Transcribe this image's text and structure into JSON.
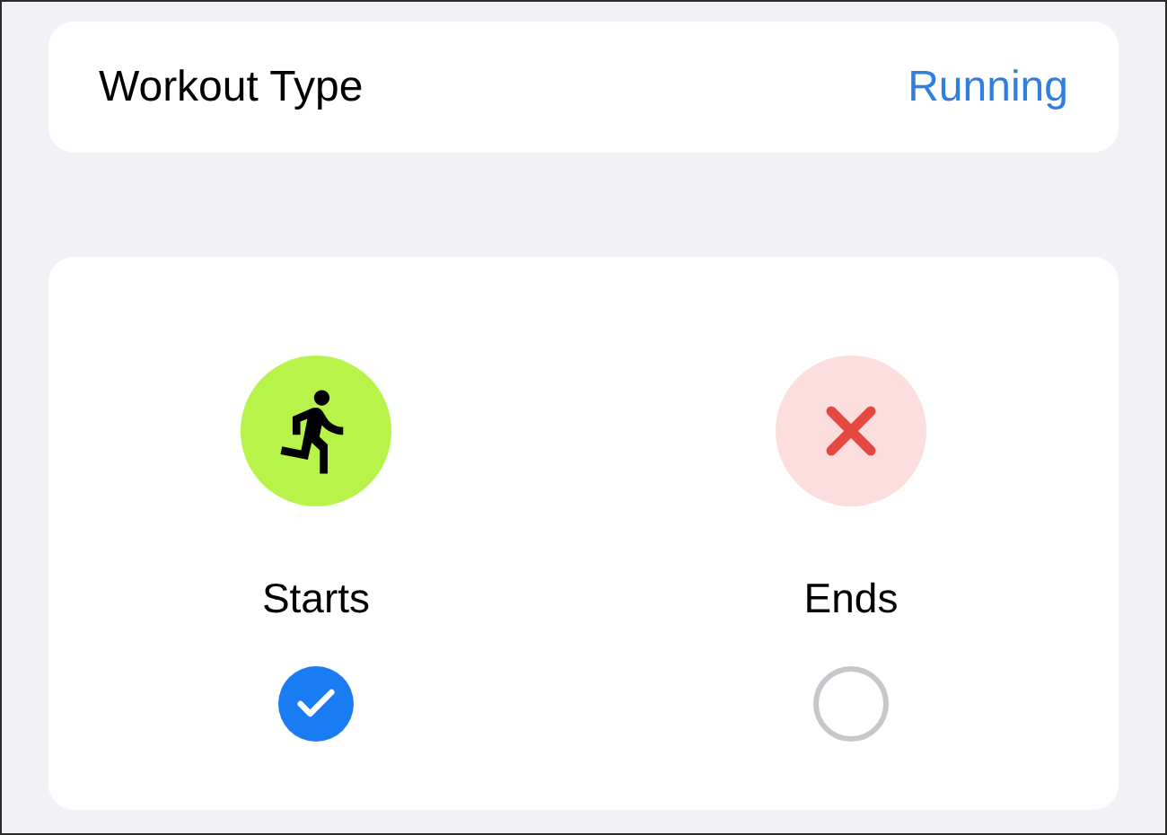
{
  "workout_type": {
    "label": "Workout Type",
    "value": "Running"
  },
  "options": [
    {
      "kind": "running",
      "label": "Starts",
      "selected": true
    },
    {
      "kind": "close",
      "label": "Ends",
      "selected": false
    }
  ]
}
